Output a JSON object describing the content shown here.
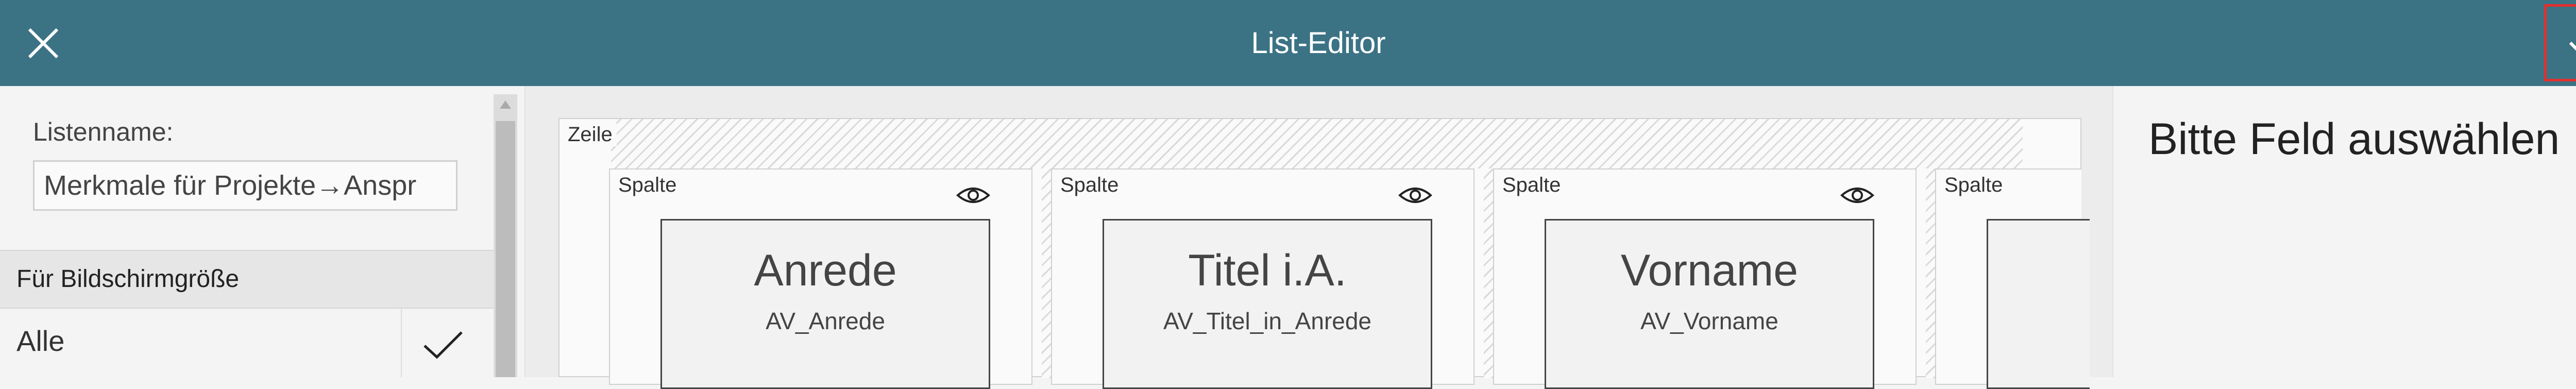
{
  "header": {
    "title": "List-Editor",
    "background": "#3b7385",
    "close_icon": "close-icon",
    "confirm_icon": "check-icon"
  },
  "left_panel": {
    "list_name_label": "Listenname:",
    "list_name_value": "Merkmale für Projekte→Anspr",
    "section_title": "Für Bildschirmgröße",
    "screen_size_items": [
      {
        "label": "Alle",
        "selected": true
      }
    ]
  },
  "canvas": {
    "row_label": "Zeile",
    "columns": [
      {
        "label": "Spalte",
        "field_title": "Anrede",
        "field_name": "AV_Anrede",
        "visibility_icon": "eye-icon"
      },
      {
        "label": "Spalte",
        "field_title": "Titel i.A.",
        "field_name": "AV_Titel_in_Anrede",
        "visibility_icon": "eye-icon"
      },
      {
        "label": "Spalte",
        "field_title": "Vorname",
        "field_name": "AV_Vorname",
        "visibility_icon": "eye-icon"
      },
      {
        "label": "Spalte"
      }
    ]
  },
  "right_panel": {
    "prompt": "Bitte Feld auswählen"
  }
}
